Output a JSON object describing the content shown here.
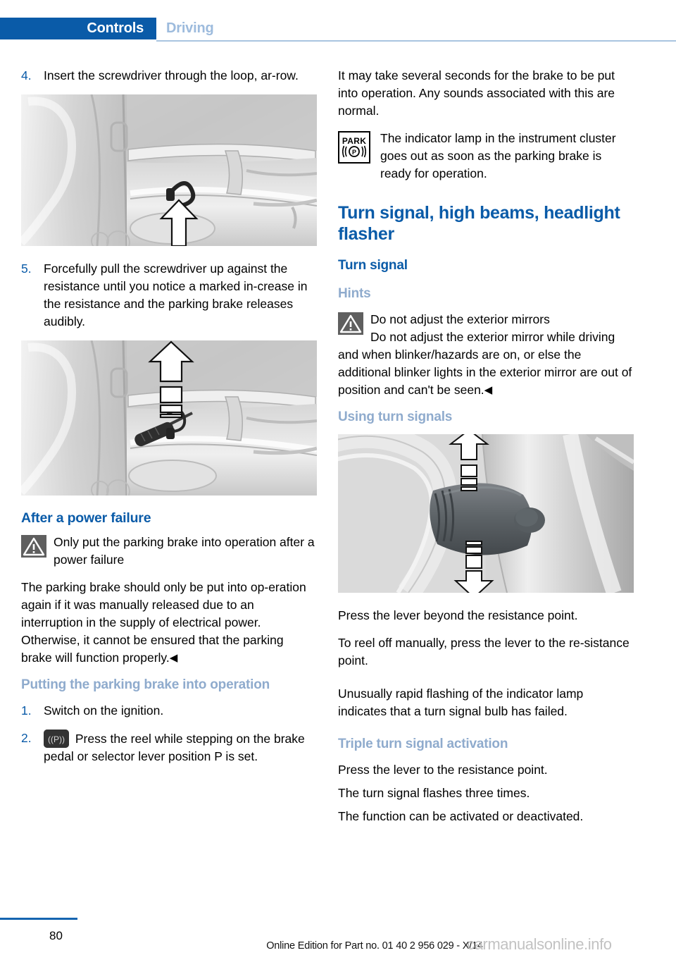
{
  "header": {
    "active_tab": "Controls",
    "inactive_tab": "Driving",
    "accent_color": "#0a5ba8",
    "muted_color": "#9dbbdd"
  },
  "left_column": {
    "step4": {
      "number": "4.",
      "text": "Insert the screwdriver through the loop, ar-row."
    },
    "figure1_name": "trunk-loop-illustration",
    "step5": {
      "number": "5.",
      "text": "Forcefully pull the screwdriver up against the resistance until you notice a marked in-crease in the resistance and the parking brake releases audibly."
    },
    "figure2_name": "screwdriver-pull-illustration",
    "heading_power_failure": "After a power failure",
    "warning_title": "Only put the parking brake into operation after a power failure",
    "warning_body": "The parking brake should only be put into op-eration again if it was manually released due to an interruption in the supply of electrical power. Otherwise, it cannot be ensured that the parking brake will function properly.",
    "heading_putting_into_operation": "Putting the parking brake into operation",
    "step1": {
      "number": "1.",
      "text": "Switch on the ignition."
    },
    "step2": {
      "number": "2.",
      "text": "Press the reel while stepping on the brake pedal or selector lever position P is set."
    }
  },
  "right_column": {
    "intro_paragraph": "It may take several seconds for the brake to be put into operation. Any sounds associated with this are normal.",
    "park_note": {
      "icon_top_label": "PARK",
      "icon_bottom_label": "((P))",
      "text": "The indicator lamp in the instrument cluster goes out as soon as the parking brake is ready for operation."
    },
    "heading_main": "Turn signal, high beams, headlight flasher",
    "heading_turn_signal": "Turn signal",
    "heading_hints": "Hints",
    "warning_title": "Do not adjust the exterior mirrors",
    "warning_body": "Do not adjust the exterior mirror while driving and when blinker/hazards are on, or else the additional blinker lights in the exterior mirror are out of position and can't be seen.",
    "heading_using_turn_signals": "Using turn signals",
    "figure3_name": "turn-signal-lever-illustration",
    "para1": "Press the lever beyond the resistance point.",
    "para2": "To reel off manually, press the lever to the re-sistance point.",
    "para3": "Unusually rapid flashing of the indicator lamp indicates that a turn signal bulb has failed.",
    "heading_triple": "Triple turn signal activation",
    "para4": "Press the lever to the resistance point.",
    "para5": "The turn signal flashes three times.",
    "para6": "The function can be activated or deactivated."
  },
  "footer": {
    "page_number": "80",
    "edition_text": "Online Edition for Part no. 01 40 2 956 029 - X/14",
    "watermark": "carmanualsonline.info"
  }
}
